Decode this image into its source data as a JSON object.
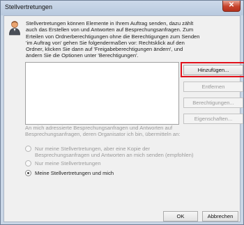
{
  "window": {
    "title": "Stellvertretungen",
    "close_glyph": "✕"
  },
  "info": {
    "lines": [
      "Stellvertretungen können Elemente in Ihrem Auftrag senden, dazu zählt",
      "auch das Erstellen von und Antworten auf Besprechungsanfragen. Zum",
      "Erteilen von Ordnerberechtigungen ohne die Berechtigungen zum Senden",
      "'im Auftrag von' gehen Sie folgendermaßen vor: Rechtsklick auf den",
      "Ordner, klicken Sie dann auf 'Freigabeberechtigungen ändern', und",
      "ändern Sie die Optionen unter 'Berechtigungen'."
    ],
    "icon": "user-icon"
  },
  "delegates_list": {
    "items": []
  },
  "buttons": {
    "add": "Hinzufügen...",
    "remove": "Entfernen",
    "permissions": "Berechtigungen...",
    "properties": "Eigenschaften...",
    "ok": "OK",
    "cancel": "Abbrechen"
  },
  "meeting_requests": {
    "description_lines": [
      "An mich adressierte Besprechungsanfragen und Antworten auf",
      "Besprechungsanfragen, deren Organisator ich bin, übermitteln an:"
    ],
    "options": [
      {
        "line1": "Nur meine Stellvertretungen, aber eine Kopie der",
        "line2": "Besprechungsanfragen und Antworten an mich senden (empfohlen)",
        "selected": false
      },
      {
        "line1": "Nur meine Stellvertretungen",
        "selected": false
      },
      {
        "line1": "Meine Stellvertretungen und mich",
        "selected": true
      }
    ]
  },
  "colors": {
    "highlight": "#e0101a",
    "close_button": "#c7432d"
  }
}
